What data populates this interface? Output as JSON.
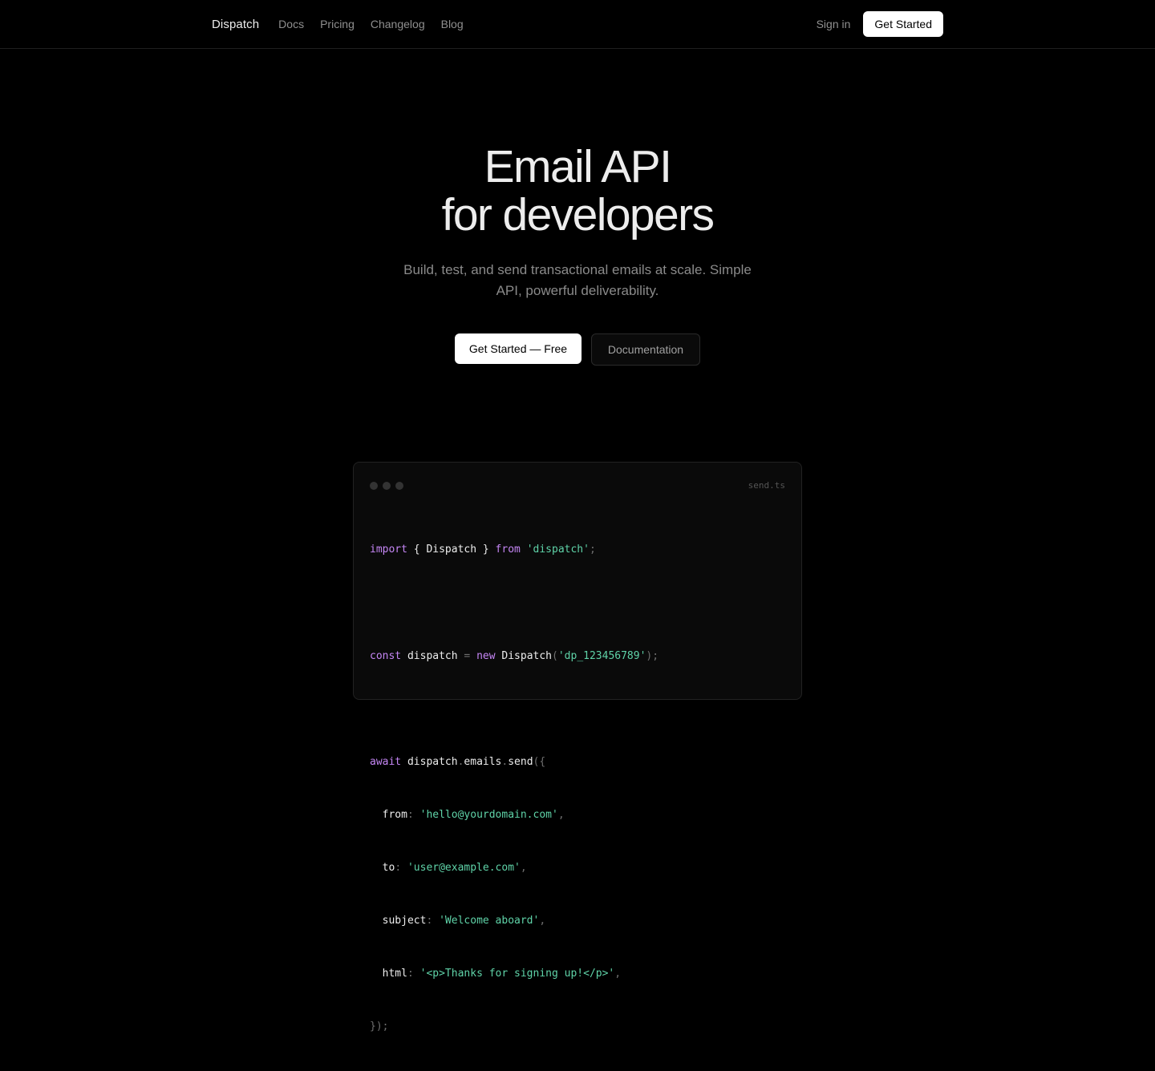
{
  "nav": {
    "brand": "Dispatch",
    "links": [
      "Docs",
      "Pricing",
      "Changelog",
      "Blog"
    ],
    "sign_in": "Sign in",
    "cta": "Get Started"
  },
  "hero": {
    "title_line1": "Email API",
    "title_line2": "for developers",
    "subtitle": "Build, test, and send transactional emails at scale. Simple API, powerful deliverability.",
    "primary_cta": "Get Started — Free",
    "secondary_cta": "Documentation"
  },
  "code_window": {
    "filename": "send.ts",
    "import_kw": "import",
    "import_name": "{ Dispatch }",
    "from_kw": "from",
    "module": "'dispatch'",
    "const_kw": "const",
    "var_name": "dispatch",
    "new_kw": "new",
    "class_name": "Dispatch",
    "api_key": "'dp_123456789'",
    "await_kw": "await",
    "call_obj": "dispatch",
    "call_prop": "emails",
    "call_method": "send",
    "fields": [
      {
        "key": "from",
        "value": "'hello@yourdomain.com'"
      },
      {
        "key": "to",
        "value": "'user@example.com'"
      },
      {
        "key": "subject",
        "value": "'Welcome aboard'"
      },
      {
        "key": "html",
        "value": "'<p>Thanks for signing up!</p>'"
      }
    ],
    "closing": "});"
  },
  "colors": {
    "background": "#000000",
    "keyword": "#c586f5",
    "string": "#5fd3a8",
    "punctuation": "#6e6e6e"
  }
}
